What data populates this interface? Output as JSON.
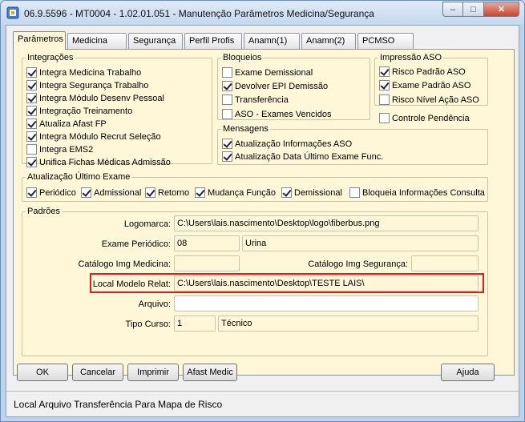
{
  "window": {
    "title": "06.9.5596 - MT0004 - 1.02.01.051 - Manutenção Parâmetros Medicina/Segurança",
    "controls": {
      "minimize": "–",
      "maximize": "□",
      "close": "✕"
    }
  },
  "tabs": [
    {
      "label": "Parâmetros",
      "active": true
    },
    {
      "label": "Medicina"
    },
    {
      "label": "Segurança"
    },
    {
      "label": "Perfil Profis"
    },
    {
      "label": "Anamn(1)"
    },
    {
      "label": "Anamn(2)"
    },
    {
      "label": "PCMSO"
    }
  ],
  "integracoes": {
    "title": "Integrações",
    "items": [
      {
        "label": "Integra Medicina Trabalho",
        "checked": true
      },
      {
        "label": "Integra Segurança Trabalho",
        "checked": true
      },
      {
        "label": "Integra Módulo Desenv Pessoal",
        "checked": true
      },
      {
        "label": "Integração Treinamento",
        "checked": true
      },
      {
        "label": "Atualiza Afast FP",
        "checked": true
      },
      {
        "label": "Integra Módulo Recrut Seleção",
        "checked": true
      },
      {
        "label": "Integra EMS2",
        "checked": false
      },
      {
        "label": "Unifica Fichas Médicas Admissão",
        "checked": true
      }
    ]
  },
  "bloqueios": {
    "title": "Bloqueios",
    "items": [
      {
        "label": "Exame Demissional",
        "checked": false
      },
      {
        "label": "Devolver EPI Demissão",
        "checked": true
      },
      {
        "label": "Transferência",
        "checked": false
      },
      {
        "label": "ASO - Exames Vencidos",
        "checked": false
      }
    ]
  },
  "impressao": {
    "title": "Impressão ASO",
    "items": [
      {
        "label": "Risco Padrão ASO",
        "checked": true
      },
      {
        "label": "Exame Padrão ASO",
        "checked": true
      },
      {
        "label": "Risco Nível Ação ASO",
        "checked": false
      }
    ]
  },
  "controle_pendencia": {
    "label": "Controle Pendência",
    "checked": false
  },
  "mensagens": {
    "title": "Mensagens",
    "items": [
      {
        "label": "Atualização Informações ASO",
        "checked": true
      },
      {
        "label": "Atualização Data Último Exame Func.",
        "checked": true
      }
    ]
  },
  "atualizacao": {
    "title": "Atualização Último Exame",
    "items": [
      {
        "label": "Periódico",
        "checked": true
      },
      {
        "label": "Admissional",
        "checked": true
      },
      {
        "label": "Retorno",
        "checked": true
      },
      {
        "label": "Mudança Função",
        "checked": true
      },
      {
        "label": "Demissional",
        "checked": true
      },
      {
        "label": "Bloqueia Informações Consulta",
        "checked": false
      }
    ]
  },
  "padroes": {
    "title": "Padrões",
    "logomarca_label": "Logomarca:",
    "logomarca_value": "C:\\Users\\lais.nascimento\\Desktop\\logo\\fiberbus.png",
    "exame_label": "Exame Periódico:",
    "exame_code": "08",
    "exame_desc": "Urina",
    "cat_med_label": "Catálogo Img Medicina:",
    "cat_med_value": "",
    "cat_seg_label": "Catálogo Img Segurança:",
    "cat_seg_value": "",
    "modelo_label": "Local Modelo Relat:",
    "modelo_value": "C:\\Users\\lais.nascimento\\Desktop\\TESTE LAIS\\",
    "arquivo_label": "Arquivo:",
    "arquivo_value": "",
    "curso_label": "Tipo Curso:",
    "curso_code": "1",
    "curso_desc": "Técnico"
  },
  "buttons": {
    "ok": "OK",
    "cancelar": "Cancelar",
    "imprimir": "Imprimir",
    "afast": "Afast Medic",
    "ajuda": "Ajuda"
  },
  "status": "Local Arquivo Transferência Para Mapa de Risco",
  "colors": {
    "highlight": "#e11b22",
    "panel": "#fff7d8"
  }
}
